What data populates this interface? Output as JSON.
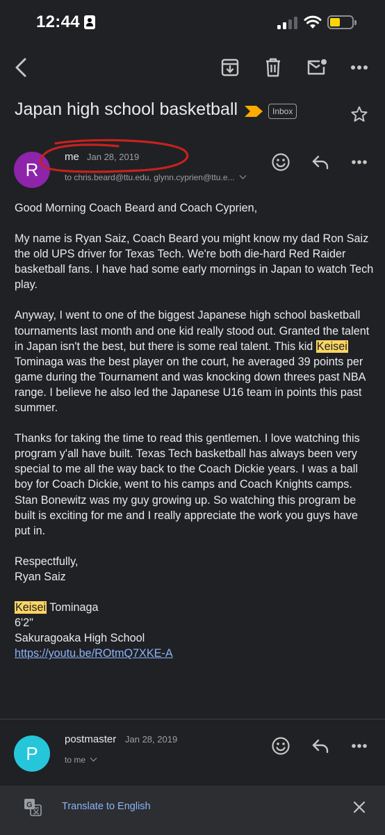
{
  "status_bar": {
    "time": "12:44"
  },
  "email": {
    "subject": "Japan high school basketball",
    "label": "Inbox",
    "message1": {
      "avatar_letter": "R",
      "avatar_color": "#8e24aa",
      "sender": "me",
      "date": "Jan 28, 2019",
      "recipients": "to chris.beard@ttu.edu, glynn.cyprien@ttu.e...",
      "body": {
        "greeting": "Good Morning Coach Beard and Coach Cyprien,",
        "p1": "My name is Ryan Saiz, Coach Beard you might know my dad Ron Saiz the old UPS driver for Texas Tech. We're both die-hard Red Raider basketball fans. I have had some early mornings in Japan to watch Tech play.",
        "p2_before": "Anyway, I went to one of the biggest Japanese high school basketball tournaments last month and one kid really stood out. Granted the talent in Japan isn't the best, but there is some real talent. This kid ",
        "p2_highlight": "Keisei",
        "p2_after": " Tominaga was the best player on the court, he averaged 39 points per game during the Tournament and was knocking down threes past NBA range. I believe he also led the Japanese U16 team in points this past summer.",
        "p3": "Thanks for taking the time to read this gentlemen. I love watching this program y'all have built. Texas Tech basketball has always been very special to me all the way back to the Coach Dickie years. I was a ball boy for Coach Dickie, went to his camps and Coach Knights camps. Stan Bonewitz was my guy growing up. So watching this program be built is exciting for me and I really appreciate the work you guys have put in.",
        "signoff": "Respectfully,",
        "signature": "Ryan Saiz",
        "player_highlight": "Keisei",
        "player_rest": " Tominaga",
        "height": "6'2\"",
        "school": "Sakuragoaka High School",
        "link": "https://youtu.be/ROtmQ7XKE-A"
      }
    },
    "message2": {
      "avatar_letter": "P",
      "avatar_color": "#26c6da",
      "sender": "postmaster",
      "date": "Jan 28, 2019",
      "recipients": "to me"
    }
  },
  "translate_bar": {
    "label": "Translate to English"
  },
  "colors": {
    "accent_link": "#8ab4f8",
    "highlight": "#fdd663",
    "important_marker": "#f9ab00",
    "annotation": "#c5221f"
  }
}
